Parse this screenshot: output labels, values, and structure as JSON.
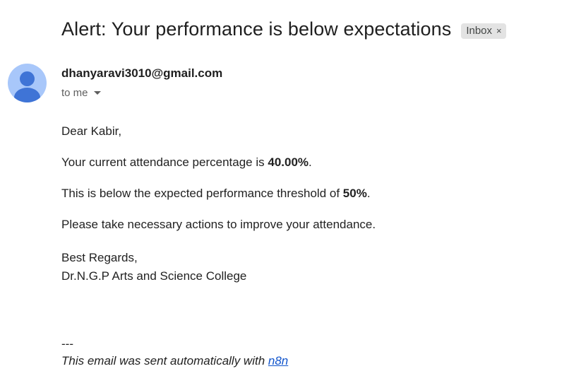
{
  "email": {
    "subject": "Alert: Your performance is below expectations",
    "label": "Inbox",
    "label_close": "×",
    "sender": "dhanyaravi3010@gmail.com",
    "recipient": "to me"
  },
  "body": {
    "greeting": "Dear Kabir,",
    "attendance_prefix": "Your current attendance percentage is ",
    "attendance_value": "40.00%",
    "attendance_suffix": ".",
    "threshold_prefix": "This is below the expected performance threshold of ",
    "threshold_value": "50%",
    "threshold_suffix": ".",
    "action": "Please take necessary actions to improve your attendance.",
    "closing": "Best Regards,",
    "signature": "Dr.N.G.P Arts and Science College"
  },
  "footer": {
    "separator": "---",
    "note_prefix": "This email was sent automatically with ",
    "link_text": "n8n"
  },
  "icons": {
    "avatar": "default-user-avatar-icon",
    "recipient_details": "caret-down-icon"
  },
  "colors": {
    "avatar_bg": "#a8c7fa",
    "avatar_fg": "#3f74d6",
    "link": "#1155cc",
    "chip_bg": "#e3e3e3"
  }
}
